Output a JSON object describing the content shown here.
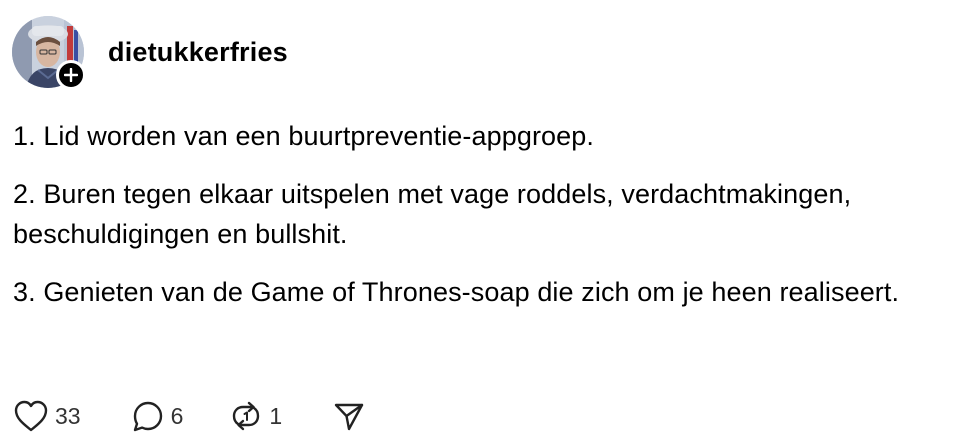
{
  "post": {
    "author": {
      "username": "dietukkerfries",
      "avatar_icon": "profile-photo",
      "follow_icon": "plus-icon"
    },
    "paragraphs": [
      "1. Lid worden van een buurtpreventie-appgroep.",
      "2. Buren tegen elkaar uitspelen met vage roddels, verdachtmakingen, beschuldigingen en bullshit.",
      "3. Genieten van de Game of Thrones-soap die zich om je heen realiseert."
    ],
    "actions": {
      "like": {
        "icon": "heart-icon",
        "count": "33"
      },
      "reply": {
        "icon": "speech-bubble-icon",
        "count": "6"
      },
      "repost": {
        "icon": "repost-icon",
        "count": "1"
      },
      "share": {
        "icon": "send-icon"
      }
    }
  }
}
